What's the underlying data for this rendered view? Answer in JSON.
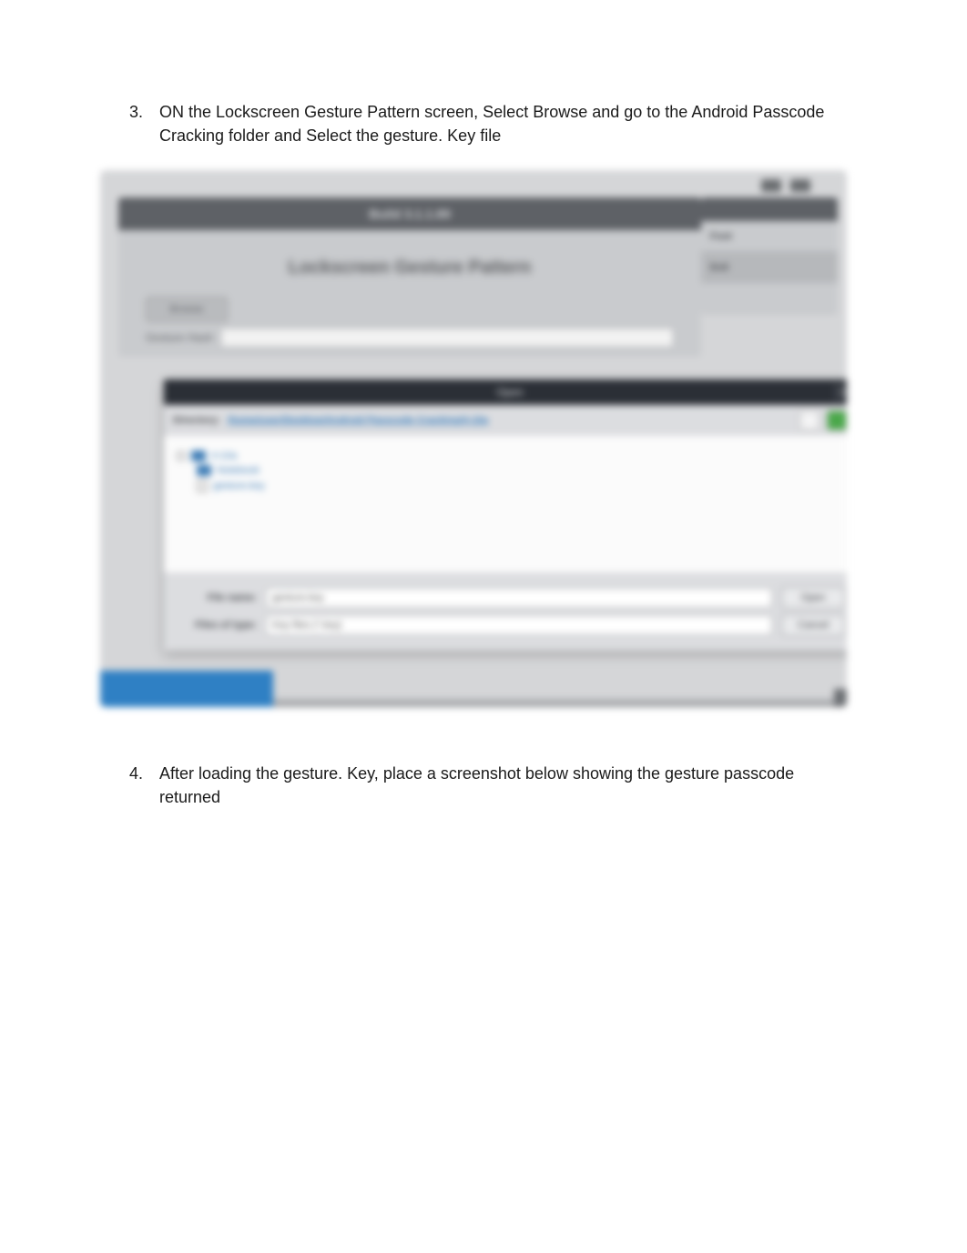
{
  "steps": {
    "step3": {
      "number": "3.",
      "text": "ON the Lockscreen Gesture Pattern screen, Select Browse and go to the Android Passcode Cracking folder and Select the gesture. Key file"
    },
    "step4": {
      "number": "4.",
      "text": "After loading the gesture. Key,  place a screenshot below showing the gesture passcode returned"
    }
  },
  "panel": {
    "header": "Build 3.1.1.89",
    "title": "Lockscreen Gesture Pattern",
    "browse": "Browse",
    "gesture_label": "Gesture Hash"
  },
  "side": {
    "row1": "Font",
    "row2": "Exit"
  },
  "dialog": {
    "title": "Open",
    "close": "×",
    "directory_label": "Directory:",
    "path": "/home/user/Desktop/Android Passcode Cracking/4-10a",
    "tree": {
      "item1": "4-10a",
      "item2": "Notebook",
      "item3": "gesture.key"
    },
    "filename_label": "File name:",
    "filename_value": "gesture.key",
    "filetype_label": "Files of type:",
    "filetype_value": "Key files (*.key)",
    "open": "Open",
    "cancel": "Cancel"
  }
}
